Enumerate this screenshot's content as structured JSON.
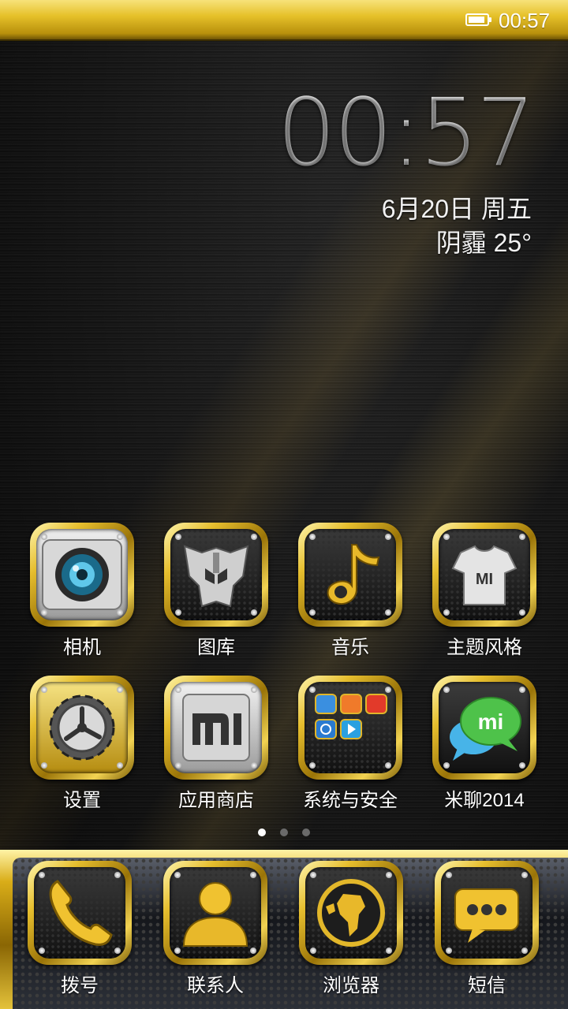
{
  "status_bar": {
    "time": "00:57",
    "battery_level": 0.9
  },
  "clock_widget": {
    "time": "00:57",
    "date": "6月20日 周五",
    "weather": "阴霾  25°"
  },
  "grid_apps": [
    {
      "label": "相机",
      "icon": "camera-icon"
    },
    {
      "label": "图库",
      "icon": "autobot-gallery-icon"
    },
    {
      "label": "音乐",
      "icon": "music-note-icon"
    },
    {
      "label": "主题风格",
      "icon": "theme-shirt-icon"
    },
    {
      "label": "设置",
      "icon": "gear-icon"
    },
    {
      "label": "应用商店",
      "icon": "mi-store-icon"
    },
    {
      "label": "系统与安全",
      "icon": "app-folder-icon"
    },
    {
      "label": "米聊2014",
      "icon": "mitalk-bubble-icon"
    }
  ],
  "pager": {
    "pages": 3,
    "current": 1
  },
  "dock_apps": [
    {
      "label": "拨号",
      "icon": "phone-icon"
    },
    {
      "label": "联系人",
      "icon": "contact-person-icon"
    },
    {
      "label": "浏览器",
      "icon": "globe-icon"
    },
    {
      "label": "短信",
      "icon": "message-icon"
    }
  ],
  "colors": {
    "gold": "#e6be2e",
    "dark_gold": "#8a6604",
    "text": "#ffffff"
  }
}
